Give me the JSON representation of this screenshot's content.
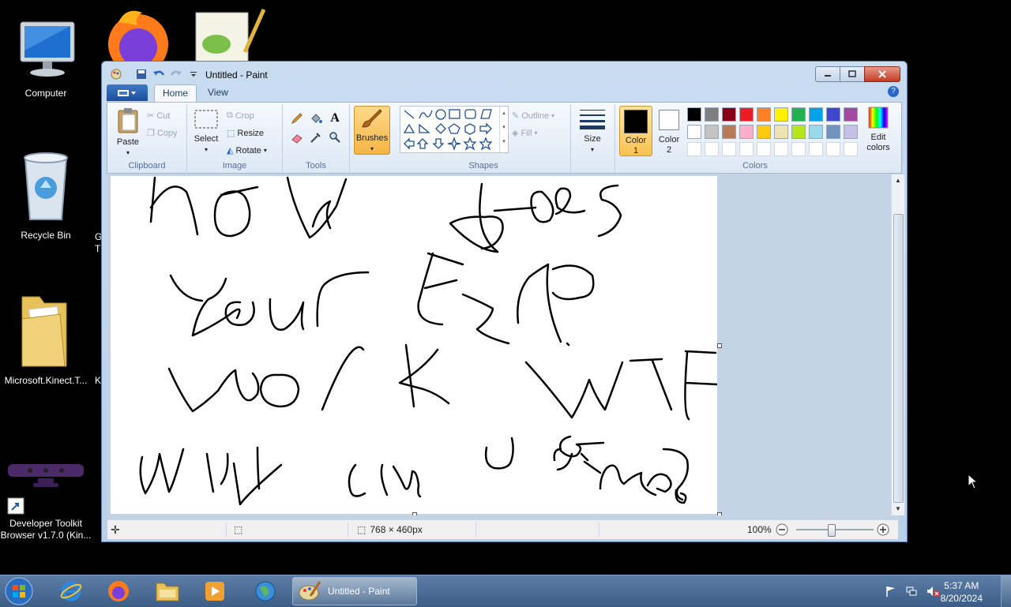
{
  "desktop": {
    "icons": [
      {
        "label": "Computer"
      },
      {
        "label": "Recycle Bin"
      },
      {
        "label": "Microsoft.Kinect.T..."
      },
      {
        "label": "Developer Toolkit Browser v1.7.0 (Kin..."
      }
    ],
    "partial_labels": [
      "G",
      "T",
      "K"
    ]
  },
  "window": {
    "title": "Untitled - Paint"
  },
  "ribbon": {
    "tabs": [
      "Home",
      "View"
    ],
    "clipboard": {
      "paste": "Paste",
      "cut": "Cut",
      "copy": "Copy",
      "group": "Clipboard"
    },
    "image": {
      "select": "Select",
      "crop": "Crop",
      "resize": "Resize",
      "rotate": "Rotate",
      "group": "Image"
    },
    "tools": {
      "group": "Tools"
    },
    "brushes": {
      "label": "Brushes"
    },
    "shapes": {
      "outline": "Outline",
      "fill": "Fill",
      "group": "Shapes"
    },
    "size": {
      "label": "Size"
    },
    "colors": {
      "color1": "Color 1",
      "color2": "Color 2",
      "edit": "Edit colors",
      "group": "Colors",
      "color1_value": "#000000",
      "color2_value": "#ffffff",
      "palette_row1": [
        "#000000",
        "#7f7f7f",
        "#880015",
        "#ed1c24",
        "#ff7f27",
        "#fff200",
        "#22b14c",
        "#00a2e8",
        "#3f48cc",
        "#a349a4"
      ],
      "palette_row2": [
        "#ffffff",
        "#c3c3c3",
        "#b97a57",
        "#ffaec9",
        "#ffc90e",
        "#efe4b0",
        "#b5e61d",
        "#99d9ea",
        "#7092be",
        "#c8bfe7"
      ]
    }
  },
  "canvas": {
    "handwriting": "how does your ESP work WTF why can u see me?"
  },
  "statusbar": {
    "size": "768 × 460px",
    "zoom": "100%",
    "zoom_level": 1.0
  },
  "taskbar": {
    "active_app": "Untitled - Paint",
    "time": "5:37 AM",
    "date": "8/20/2024"
  }
}
